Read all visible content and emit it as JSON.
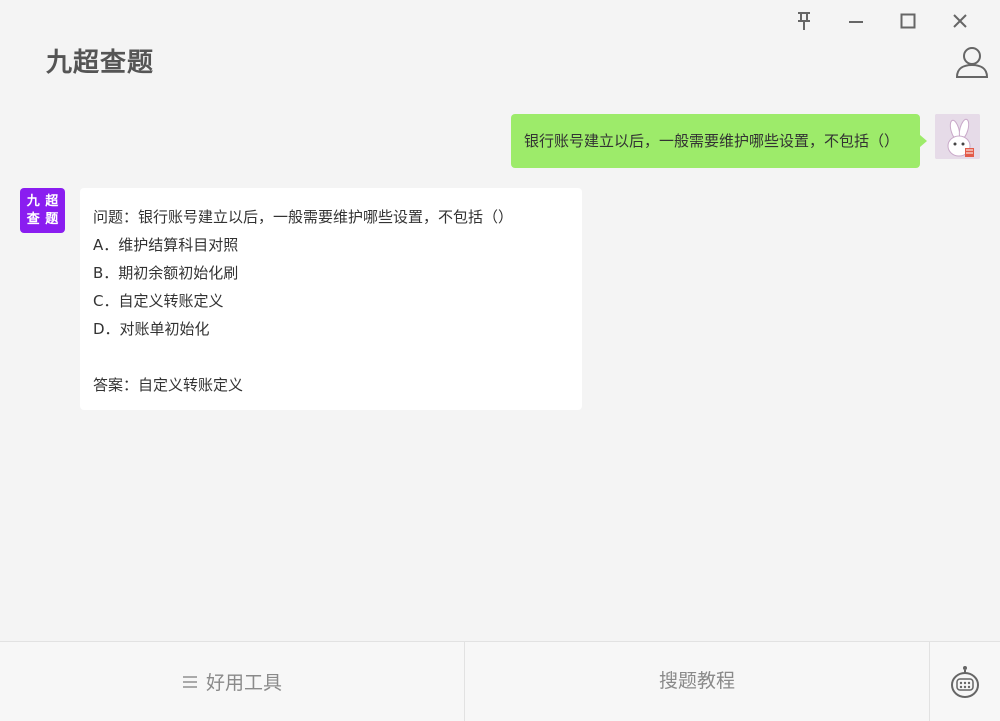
{
  "app": {
    "title": "九超查题"
  },
  "window_controls": [
    "pin-icon",
    "minimize-icon",
    "maximize-icon",
    "close-icon"
  ],
  "user_message": "银行账号建立以后，一般需要维护哪些设置，不包括（）",
  "bot_avatar": [
    "九",
    "超",
    "查",
    "题"
  ],
  "bot_reply": {
    "question": "问题：银行账号建立以后，一般需要维护哪些设置，不包括（）",
    "options": [
      "A．维护结算科目对照",
      "B．期初余额初始化刷",
      "C．自定义转账定义",
      "D．对账单初始化"
    ],
    "answer": "答案：自定义转账定义"
  },
  "footer": {
    "tools_label": "好用工具",
    "guide_label": "搜题教程"
  },
  "colors": {
    "user_bubble": "#9deb6a",
    "bot_avatar": "#8a1df0",
    "background": "#f4f4f4"
  }
}
